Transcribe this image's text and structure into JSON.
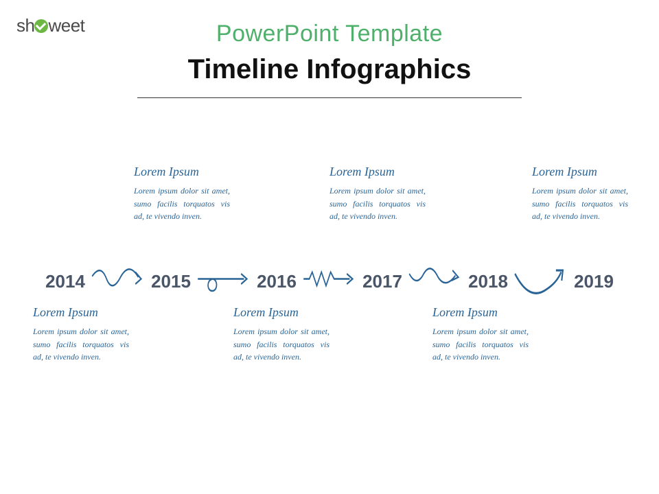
{
  "logo": {
    "pre": "sh",
    "post": "weet"
  },
  "header": {
    "template_label": "PowerPoint Template",
    "title": "Timeline Infographics"
  },
  "timeline": {
    "years": [
      "2014",
      "2015",
      "2016",
      "2017",
      "2018",
      "2019"
    ]
  },
  "notes_top": [
    {
      "heading": "Lorem Ipsum",
      "body": "Lorem ipsum dolor sit amet, sumo facilis torquatos vis ad, te vivendo inven."
    },
    {
      "heading": "Lorem Ipsum",
      "body": "Lorem ipsum dolor sit amet, sumo facilis torquatos vis ad, te vivendo inven."
    },
    {
      "heading": "Lorem Ipsum",
      "body": "Lorem ipsum dolor sit amet, sumo facilis torquatos vis ad, te vivendo inven."
    }
  ],
  "notes_bottom": [
    {
      "heading": "Lorem Ipsum",
      "body": "Lorem ipsum dolor sit amet, sumo facilis torquatos vis ad, te vivendo inven."
    },
    {
      "heading": "Lorem Ipsum",
      "body": "Lorem ipsum dolor sit amet, sumo facilis torquatos vis ad, te vivendo inven."
    },
    {
      "heading": "Lorem Ipsum",
      "body": "Lorem ipsum dolor sit amet, sumo facilis torquatos vis ad, te vivendo inven."
    }
  ],
  "colors": {
    "arrow": "#2a6496"
  }
}
